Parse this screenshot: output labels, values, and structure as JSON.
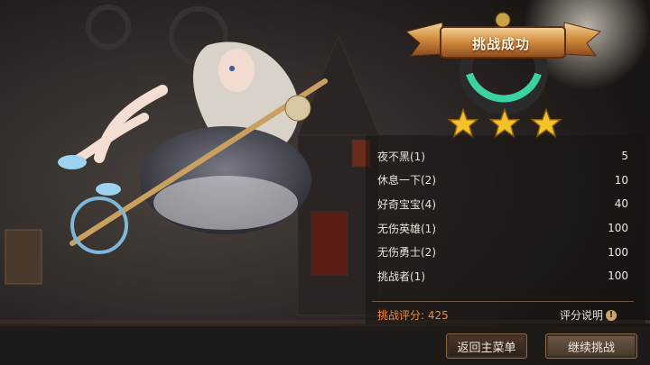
{
  "result": {
    "title": "挑战成功",
    "stars_earned": 3,
    "stars_max": 3
  },
  "achievements": [
    {
      "name": "夜不黑(1)",
      "points": "5"
    },
    {
      "name": "休息一下(2)",
      "points": "10"
    },
    {
      "name": "好奇宝宝(4)",
      "points": "40"
    },
    {
      "name": "无伤英雄(1)",
      "points": "100"
    },
    {
      "name": "无伤勇士(2)",
      "points": "100"
    },
    {
      "name": "挑战者(1)",
      "points": "100"
    }
  ],
  "score": {
    "text": "挑战评分: 425",
    "help_label": "评分说明",
    "help_icon": "!"
  },
  "buttons": {
    "back": "返回主菜单",
    "continue": "继续挑战"
  },
  "colors": {
    "accent": "#ef8a3c",
    "star": "#f3c12a",
    "ring": "#3bd1a0"
  }
}
